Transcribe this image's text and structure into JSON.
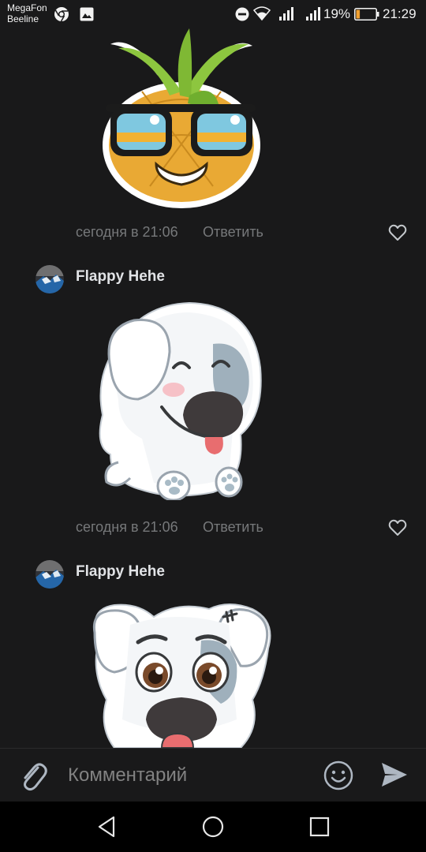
{
  "status_bar": {
    "carrier_1": "MegaFon",
    "carrier_2": "Beeline",
    "battery": "19%",
    "time": "21:29"
  },
  "comments": [
    {
      "sticker_icon": "pineapple-sunglasses-sticker",
      "timestamp": "сегодня в 21:06",
      "reply_label": "Ответить"
    },
    {
      "author": "Flappy Hehe",
      "sticker_icon": "smiling-dog-sticker",
      "timestamp": "сегодня в 21:06",
      "reply_label": "Ответить"
    },
    {
      "author": "Flappy Hehe",
      "sticker_icon": "dog-face-sticker"
    }
  ],
  "composer": {
    "placeholder": "Комментарий"
  },
  "colors": {
    "background": "#19191a",
    "secondary_text": "#76787a",
    "battery_level": "#f0a030"
  }
}
